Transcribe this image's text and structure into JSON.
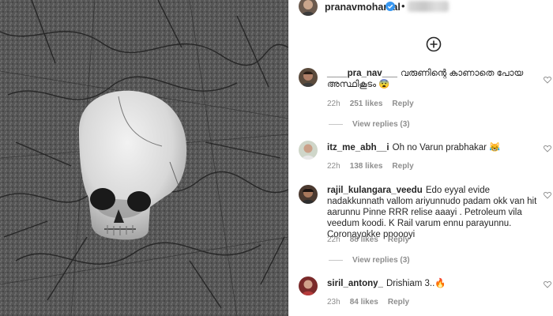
{
  "post": {
    "username": "pranavmohanlal",
    "separator": "•"
  },
  "comments": [
    {
      "username": "____pra_nav___",
      "text": "വരുണിന്റെ കാണാതെ പോയ അസ്ഥികൂടം 😨",
      "time": "22h",
      "likes": "251 likes",
      "reply": "Reply",
      "view_replies": "View replies (3)"
    },
    {
      "username": "itz_me_abh__i",
      "text": "Oh no Varun prabhakar 😹",
      "time": "22h",
      "likes": "138 likes",
      "reply": "Reply"
    },
    {
      "username": "rajil_kulangara_veedu",
      "text": "Edo eyyal evide nadakkunnath vallom ariyunnudo padam okk van hit aarunnu Pinne RRR relise aaayi . Petroleum vila veedum koodi. K Rail varum ennu parayunnu. Coronayokke ppoooyi",
      "time": "22h",
      "likes": "88 likes",
      "reply": "Reply",
      "view_replies": "View replies (3)"
    },
    {
      "username": "siril_antony_",
      "text": "Drishiam 3..🔥",
      "time": "23h",
      "likes": "84 likes",
      "reply": "Reply"
    }
  ],
  "icons": {
    "add": "plus-circle-icon",
    "verified": "verified-badge-icon",
    "like": "heart-icon"
  },
  "colors": {
    "verified": "#3897f0",
    "meta": "#8e8e8e",
    "text": "#262626"
  }
}
